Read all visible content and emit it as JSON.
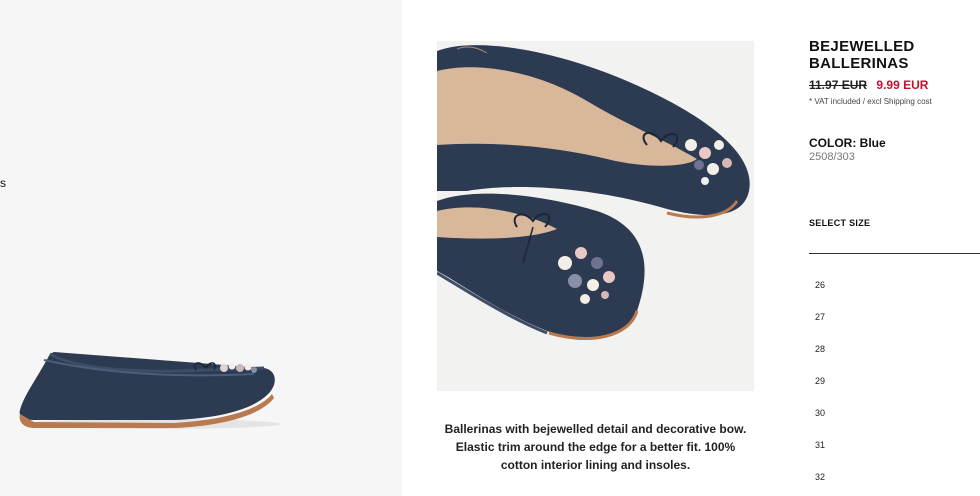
{
  "product": {
    "title": "BEJEWELLED BALLERINAS",
    "old_price": "11.97 EUR",
    "new_price": "9.99 EUR",
    "vat_note": "* VAT included / excl Shipping cost",
    "color_label": "COLOR:",
    "color_value": "Blue",
    "sku": "2508/303",
    "description": "Ballerinas with bejewelled detail and decorative bow. Elastic trim around the edge for a better fit. 100% cotton interior lining and insoles."
  },
  "left_stray_text": "s",
  "size_selector": {
    "label": "SELECT SIZE",
    "sizes": [
      "26",
      "27",
      "28",
      "29",
      "30",
      "31",
      "32"
    ]
  },
  "colors": {
    "sale_red": "#c8102e",
    "shoe_navy": "#2c3a52"
  }
}
